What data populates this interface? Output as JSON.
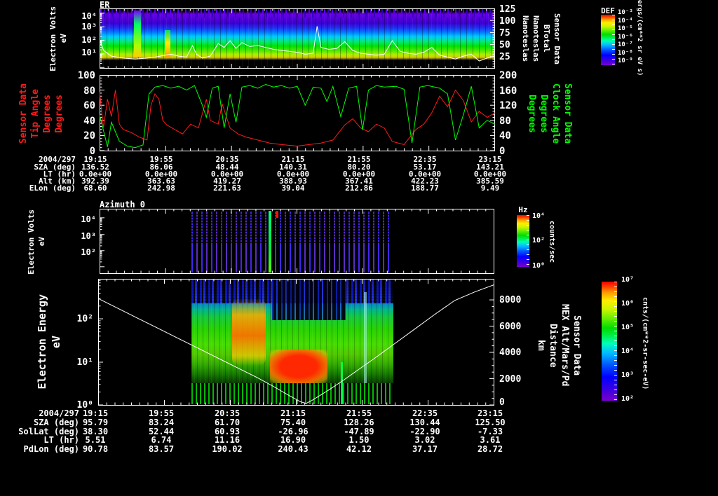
{
  "plot1": {
    "title": "ER",
    "ylabel_lines": [
      "Electron Volts",
      "eV"
    ],
    "yticks": [
      "10⁴",
      "10³",
      "10²",
      "10¹"
    ],
    "right_ticks": [
      "125",
      "100",
      "75",
      "50",
      "25"
    ],
    "right_label_lines": [
      "Sensor Data",
      "BTotal",
      "Nanoteslas",
      "Nanoteslas"
    ]
  },
  "colorbar1": {
    "title": "DEF",
    "ticks": [
      "10⁻³",
      "10⁻⁴",
      "10⁻⁵",
      "10⁻⁶",
      "10⁻⁷",
      "10⁻⁸",
      "10⁻⁹"
    ],
    "unit": "ergs/(cm**2 sr eV s)"
  },
  "plot2": {
    "left_label_lines": [
      "Sensor Data",
      "Tip Angle",
      "Degrees",
      "Degrees"
    ],
    "left_ticks": [
      "100",
      "80",
      "60",
      "40",
      "20",
      "0"
    ],
    "right_label_lines": [
      "Sensor Data",
      "Clock Angle",
      "Degrees",
      "Degrees"
    ],
    "right_ticks": [
      "200",
      "160",
      "120",
      "80",
      "40",
      "0"
    ],
    "left_color": "#ff1a1a",
    "right_color": "#00ff00"
  },
  "table1": {
    "date_label": "2004/297",
    "times": [
      "19:15",
      "19:55",
      "20:35",
      "21:15",
      "21:55",
      "22:35",
      "23:15"
    ],
    "rows": [
      {
        "label": "SZA (deg)",
        "values": [
          "136.52",
          "86.06",
          "48.44",
          "140.31",
          "80.20",
          "53.17",
          "143.21"
        ]
      },
      {
        "label": "LT (hr)",
        "values": [
          "0.0e+00",
          "0.0e+00",
          "0.0e+00",
          "0.0e+00",
          "0.0e+00",
          "0.0e+00",
          "0.0e+00"
        ]
      },
      {
        "label": "Alt (km)",
        "values": [
          "392.39",
          "363.63",
          "419.27",
          "388.93",
          "367.41",
          "422.23",
          "385.59"
        ]
      },
      {
        "label": "ELon (deg)",
        "values": [
          "68.60",
          "242.98",
          "221.63",
          "39.04",
          "212.86",
          "188.77",
          "9.49"
        ]
      }
    ]
  },
  "plot3": {
    "title": "Azimuth 0",
    "ylabel_lines": [
      "Electron Volts",
      "eV"
    ],
    "yticks": [
      "10⁴",
      "10³",
      "10²"
    ]
  },
  "colorbar2": {
    "title": "Hz",
    "ticks": [
      "10⁴",
      "10²",
      "10⁰"
    ],
    "unit": "counts/sec"
  },
  "plot4": {
    "ylabel_lines": [
      "Electron Energy",
      "eV"
    ],
    "yticks": [
      "10²",
      "10¹",
      "10⁰"
    ],
    "right_ticks": [
      "8000",
      "6000",
      "4000",
      "2000",
      "0"
    ],
    "right_label_lines": [
      "Sensor Data",
      "MEX Alt/Mars/Pd",
      "Distance",
      "km"
    ]
  },
  "colorbar3": {
    "ticks": [
      "10⁷",
      "10⁶",
      "10⁵",
      "10⁴",
      "10³",
      "10²"
    ],
    "unit": "cnts/(cm**2-sr-sec-eV)"
  },
  "table2": {
    "date_label": "2004/297",
    "times": [
      "19:15",
      "19:55",
      "20:35",
      "21:15",
      "21:55",
      "22:35",
      "23:15"
    ],
    "rows": [
      {
        "label": "SZA (deg)",
        "values": [
          "95.79",
          "83.24",
          "61.70",
          "75.40",
          "128.26",
          "130.44",
          "125.50"
        ]
      },
      {
        "label": "SolLat (deg)",
        "values": [
          "38.30",
          "52.44",
          "60.93",
          "-26.96",
          "-47.89",
          "-22.90",
          "-7.33"
        ]
      },
      {
        "label": "LT (hr)",
        "values": [
          "5.51",
          "6.74",
          "11.16",
          "16.90",
          "1.50",
          "3.02",
          "3.61"
        ]
      },
      {
        "label": "PdLon (deg)",
        "values": [
          "90.78",
          "83.57",
          "190.02",
          "240.43",
          "42.12",
          "37.17",
          "28.72"
        ]
      }
    ]
  },
  "chart_data": [
    {
      "id": "er_spectrogram",
      "type": "heatmap",
      "plot": "plot1",
      "title": "ER",
      "x": {
        "start": "19:15",
        "end": "23:15",
        "date": "2004/297"
      },
      "y": {
        "label": "Electron Volts eV",
        "scale": "log",
        "range": [
          10,
          10000
        ]
      },
      "z": {
        "label": "DEF",
        "unit": "ergs/(cm**2 sr eV s)",
        "range": [
          1e-09,
          0.001
        ]
      }
    },
    {
      "id": "btotal",
      "type": "line",
      "plot": "plot1",
      "name": "BTotal (Nanoteslas)",
      "color": "#ffffff",
      "yrange": [
        0,
        125
      ],
      "points": [
        [
          0,
          62
        ],
        [
          0.01,
          38
        ],
        [
          0.03,
          26
        ],
        [
          0.06,
          22
        ],
        [
          0.09,
          20
        ],
        [
          0.12,
          22
        ],
        [
          0.14,
          24
        ],
        [
          0.16,
          27
        ],
        [
          0.18,
          30
        ],
        [
          0.2,
          26
        ],
        [
          0.22,
          24
        ],
        [
          0.235,
          48
        ],
        [
          0.245,
          30
        ],
        [
          0.26,
          22
        ],
        [
          0.28,
          26
        ],
        [
          0.3,
          52
        ],
        [
          0.315,
          44
        ],
        [
          0.33,
          58
        ],
        [
          0.345,
          42
        ],
        [
          0.36,
          54
        ],
        [
          0.38,
          46
        ],
        [
          0.4,
          48
        ],
        [
          0.42,
          44
        ],
        [
          0.44,
          40
        ],
        [
          0.46,
          38
        ],
        [
          0.48,
          36
        ],
        [
          0.5,
          34
        ],
        [
          0.52,
          30
        ],
        [
          0.54,
          32
        ],
        [
          0.55,
          88
        ],
        [
          0.56,
          44
        ],
        [
          0.58,
          40
        ],
        [
          0.6,
          42
        ],
        [
          0.62,
          56
        ],
        [
          0.64,
          38
        ],
        [
          0.66,
          32
        ],
        [
          0.68,
          30
        ],
        [
          0.7,
          28
        ],
        [
          0.72,
          30
        ],
        [
          0.74,
          58
        ],
        [
          0.76,
          36
        ],
        [
          0.78,
          32
        ],
        [
          0.8,
          30
        ],
        [
          0.82,
          34
        ],
        [
          0.84,
          44
        ],
        [
          0.86,
          28
        ],
        [
          0.88,
          24
        ],
        [
          0.9,
          20
        ],
        [
          0.92,
          26
        ],
        [
          0.94,
          30
        ],
        [
          0.96,
          16
        ],
        [
          0.98,
          22
        ],
        [
          1,
          26
        ]
      ]
    },
    {
      "id": "tip_angle",
      "type": "line",
      "plot": "plot2",
      "name": "Tip Angle (Degrees)",
      "color": "#ff1a1a",
      "yrange": [
        0,
        100
      ],
      "points": [
        [
          0,
          78
        ],
        [
          0.01,
          30
        ],
        [
          0.02,
          68
        ],
        [
          0.03,
          45
        ],
        [
          0.04,
          80
        ],
        [
          0.05,
          35
        ],
        [
          0.06,
          28
        ],
        [
          0.08,
          24
        ],
        [
          0.1,
          18
        ],
        [
          0.12,
          14
        ],
        [
          0.13,
          60
        ],
        [
          0.14,
          75
        ],
        [
          0.15,
          68
        ],
        [
          0.16,
          40
        ],
        [
          0.17,
          34
        ],
        [
          0.19,
          28
        ],
        [
          0.21,
          22
        ],
        [
          0.23,
          35
        ],
        [
          0.25,
          30
        ],
        [
          0.27,
          68
        ],
        [
          0.28,
          40
        ],
        [
          0.3,
          35
        ],
        [
          0.31,
          62
        ],
        [
          0.33,
          30
        ],
        [
          0.35,
          22
        ],
        [
          0.37,
          18
        ],
        [
          0.4,
          14
        ],
        [
          0.43,
          10
        ],
        [
          0.46,
          8
        ],
        [
          0.5,
          6
        ],
        [
          0.53,
          8
        ],
        [
          0.56,
          10
        ],
        [
          0.59,
          14
        ],
        [
          0.62,
          34
        ],
        [
          0.64,
          42
        ],
        [
          0.66,
          30
        ],
        [
          0.68,
          25
        ],
        [
          0.7,
          35
        ],
        [
          0.72,
          30
        ],
        [
          0.74,
          12
        ],
        [
          0.77,
          8
        ],
        [
          0.8,
          28
        ],
        [
          0.82,
          35
        ],
        [
          0.84,
          50
        ],
        [
          0.86,
          72
        ],
        [
          0.88,
          58
        ],
        [
          0.9,
          80
        ],
        [
          0.92,
          66
        ],
        [
          0.94,
          38
        ],
        [
          0.96,
          52
        ],
        [
          0.98,
          44
        ],
        [
          1,
          50
        ]
      ]
    },
    {
      "id": "clock_angle",
      "type": "line",
      "plot": "plot2",
      "name": "Clock Angle (Degrees)",
      "color": "#00ff00",
      "yrange": [
        0,
        200
      ],
      "points": [
        [
          0,
          95
        ],
        [
          0.02,
          10
        ],
        [
          0.03,
          75
        ],
        [
          0.05,
          25
        ],
        [
          0.07,
          12
        ],
        [
          0.09,
          8
        ],
        [
          0.11,
          15
        ],
        [
          0.125,
          150
        ],
        [
          0.14,
          168
        ],
        [
          0.16,
          172
        ],
        [
          0.18,
          165
        ],
        [
          0.2,
          170
        ],
        [
          0.22,
          160
        ],
        [
          0.24,
          172
        ],
        [
          0.26,
          120
        ],
        [
          0.27,
          88
        ],
        [
          0.285,
          165
        ],
        [
          0.3,
          170
        ],
        [
          0.315,
          60
        ],
        [
          0.33,
          150
        ],
        [
          0.345,
          75
        ],
        [
          0.36,
          168
        ],
        [
          0.38,
          172
        ],
        [
          0.4,
          165
        ],
        [
          0.42,
          175
        ],
        [
          0.44,
          168
        ],
        [
          0.46,
          172
        ],
        [
          0.48,
          165
        ],
        [
          0.5,
          170
        ],
        [
          0.52,
          120
        ],
        [
          0.54,
          168
        ],
        [
          0.56,
          165
        ],
        [
          0.575,
          130
        ],
        [
          0.59,
          170
        ],
        [
          0.61,
          90
        ],
        [
          0.63,
          165
        ],
        [
          0.65,
          170
        ],
        [
          0.665,
          55
        ],
        [
          0.68,
          160
        ],
        [
          0.7,
          172
        ],
        [
          0.72,
          168
        ],
        [
          0.75,
          170
        ],
        [
          0.77,
          162
        ],
        [
          0.79,
          20
        ],
        [
          0.81,
          168
        ],
        [
          0.83,
          172
        ],
        [
          0.86,
          165
        ],
        [
          0.88,
          150
        ],
        [
          0.9,
          28
        ],
        [
          0.92,
          95
        ],
        [
          0.94,
          170
        ],
        [
          0.96,
          60
        ],
        [
          0.98,
          80
        ],
        [
          1,
          70
        ]
      ]
    },
    {
      "id": "azimuth0_spectrogram",
      "type": "heatmap",
      "plot": "plot3",
      "title": "Azimuth 0",
      "x": {
        "start": "19:15",
        "end": "23:15",
        "date": "2004/297"
      },
      "y": {
        "label": "Electron Volts eV",
        "scale": "log",
        "range": [
          10,
          30000
        ]
      },
      "z": {
        "label": "Hz",
        "unit": "counts/sec",
        "range": [
          1,
          10000
        ]
      }
    },
    {
      "id": "electron_energy_spectrogram",
      "type": "heatmap",
      "plot": "plot4",
      "x": {
        "start": "19:15",
        "end": "23:15",
        "date": "2004/297"
      },
      "y": {
        "label": "Electron Energy eV",
        "scale": "log",
        "range": [
          1,
          1000
        ]
      },
      "z": {
        "unit": "cnts/(cm**2-sr-sec-eV)",
        "range": [
          100,
          10000000
        ]
      }
    },
    {
      "id": "mex_distance",
      "type": "line",
      "plot": "plot4",
      "name": "MEX Alt/Mars/Pd Distance (km)",
      "color": "#ffffff",
      "yrange": [
        0,
        9600
      ],
      "points": [
        [
          0,
          8100
        ],
        [
          0.05,
          7350
        ],
        [
          0.1,
          6600
        ],
        [
          0.15,
          5850
        ],
        [
          0.2,
          5100
        ],
        [
          0.25,
          4350
        ],
        [
          0.3,
          3600
        ],
        [
          0.35,
          2850
        ],
        [
          0.4,
          2100
        ],
        [
          0.44,
          1450
        ],
        [
          0.48,
          750
        ],
        [
          0.51,
          250
        ],
        [
          0.525,
          120
        ],
        [
          0.54,
          350
        ],
        [
          0.58,
          1100
        ],
        [
          0.62,
          1900
        ],
        [
          0.66,
          2750
        ],
        [
          0.7,
          3600
        ],
        [
          0.75,
          4700
        ],
        [
          0.8,
          5800
        ],
        [
          0.85,
          6900
        ],
        [
          0.9,
          7950
        ],
        [
          0.95,
          8600
        ],
        [
          1,
          9150
        ]
      ]
    }
  ]
}
